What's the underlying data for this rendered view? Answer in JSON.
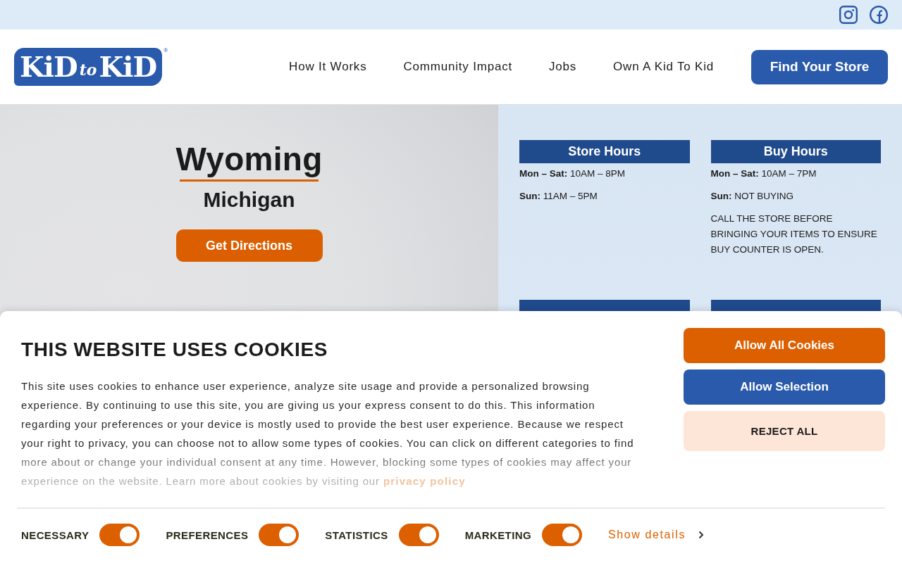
{
  "top_bar": {
    "social_links": [
      {
        "kind": "instagram"
      },
      {
        "kind": "facebook"
      }
    ]
  },
  "header": {
    "logo": {
      "parts": [
        {
          "text": "KiD",
          "kind": "large"
        },
        {
          "text": "to",
          "kind": "small"
        },
        {
          "text": "KiD",
          "kind": "large"
        }
      ],
      "mark": "®"
    },
    "nav": [
      "How It Works",
      "Community Impact",
      "Jobs",
      "Own A Kid To Kid"
    ],
    "cta": "Find Your Store"
  },
  "store": {
    "city": "Wyoming",
    "state": "Michigan",
    "directions_button": "Get Directions"
  },
  "info_cards": [
    {
      "kind": "hours",
      "title": "Store Hours",
      "lines": [
        "**Mon – Sat:** 10AM – 8PM",
        "**Sun:** 11AM – 5PM"
      ]
    },
    {
      "kind": "hours",
      "title": "Buy Hours",
      "lines": [
        "**Mon – Sat:** 10AM – 7PM",
        "**Sun:** NOT BUYING",
        "CALL THE STORE BEFORE BRINGING YOUR ITEMS TO ENSURE BUY COUNTER IS OPEN."
      ]
    },
    {
      "kind": "covered"
    },
    {
      "kind": "covered"
    }
  ],
  "cookie_banner": {
    "title": "THIS WEBSITE USES COOKIES",
    "text": "This site uses cookies to enhance user experience, analyze site usage and provide a personalized browsing experience. By continuing to use this site, you are giving us your express consent to do this. This information regarding your preferences or your device is mostly used to provide the best user experience. Because we respect your right to privacy, you can choose not to allow some types of cookies. You can click on different categories to find more about or change your individual consent at any time. However, blocking some types of cookies may affect your experience on the website. Learn more about cookies by visiting our",
    "link_text": "privacy policy",
    "buttons": [
      {
        "label": "Allow All Cookies",
        "kind": "accept"
      },
      {
        "label": "Allow Selection",
        "kind": "selection"
      },
      {
        "label": "REJECT ALL",
        "kind": "reject"
      }
    ],
    "toggles": [
      {
        "label": "NECESSARY",
        "on": true
      },
      {
        "label": "PREFERENCES",
        "on": true
      },
      {
        "label": "STATISTICS",
        "on": true
      },
      {
        "label": "MARKETING",
        "on": true
      }
    ],
    "details_link": "Show details"
  }
}
